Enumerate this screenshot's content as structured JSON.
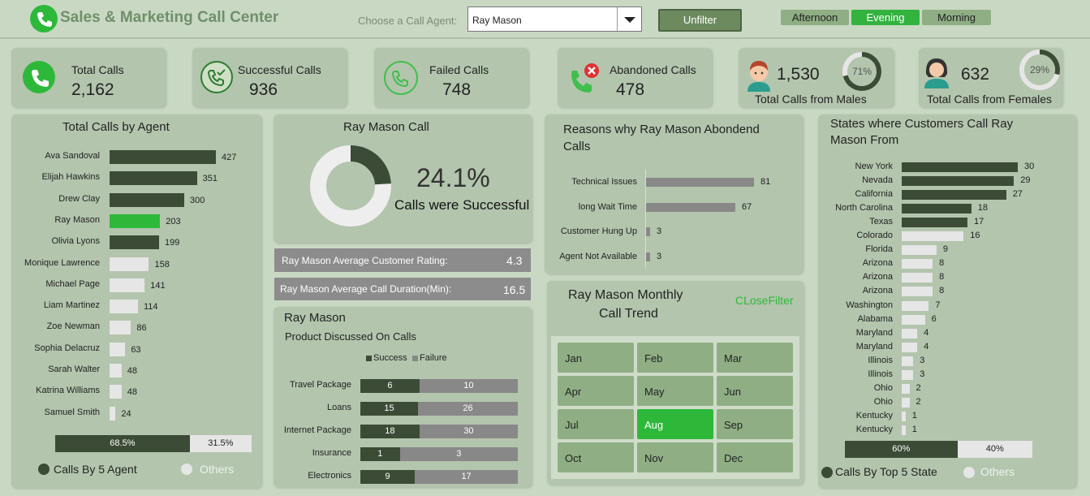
{
  "header": {
    "title": "Sales & Marketing Call Center",
    "agent_label": "Choose a Call Agent:",
    "agent_selected": "Ray Mason",
    "unfilter_label": "Unfilter",
    "time_slicers": [
      {
        "label": "Afternoon",
        "active": false
      },
      {
        "label": "Evening",
        "active": true
      },
      {
        "label": "Morning",
        "active": false
      }
    ]
  },
  "kpis": {
    "total_calls": {
      "label": "Total Calls",
      "value": "2,162"
    },
    "successful_calls": {
      "label": "Successful Calls",
      "value": "936"
    },
    "failed_calls": {
      "label": "Failed Calls",
      "value": "748"
    },
    "abandoned_calls": {
      "label": "Abandoned Calls",
      "value": "478"
    },
    "males": {
      "label": "Total Calls from Males",
      "value": "1,530",
      "pct": "71%",
      "fraction": 0.71
    },
    "females": {
      "label": "Total Calls from Females",
      "value": "632",
      "pct": "29%",
      "fraction": 0.29
    }
  },
  "agents_panel": {
    "title": "Total Calls by Agent",
    "split_left": "68.5%",
    "split_right": "31.5%",
    "split_fraction": 0.685,
    "legend_left": "Calls By 5 Agent",
    "legend_right": "Others"
  },
  "success_panel": {
    "title": "Ray Mason Call",
    "pct": "24.1%",
    "fraction": 0.241,
    "caption": "Calls were Successful",
    "rating_label": "Ray Mason Average Customer Rating:",
    "rating_value": "4.3",
    "duration_label": "Ray Mason Average Call Duration(Min):",
    "duration_value": "16.5"
  },
  "product_panel": {
    "title": "Ray Mason",
    "subtitle": "Product Discussed On Calls",
    "legend_success": "Success",
    "legend_failure": "Failure"
  },
  "reasons_panel": {
    "title_line1": "Reasons why Ray Mason Abondend",
    "title_line2": "Calls"
  },
  "monthly_panel": {
    "title_line1": "Ray Mason Monthly",
    "title_line2": "Call Trend",
    "close_filter": "CLoseFilter",
    "months": [
      "Jan",
      "Feb",
      "Mar",
      "Apr",
      "May",
      "Jun",
      "Jul",
      "Aug",
      "Sep",
      "Oct",
      "Nov",
      "Dec"
    ],
    "active_month": "Aug"
  },
  "states_panel": {
    "title_line1": "States where Customers Call Ray",
    "title_line2": "Mason From",
    "split_left": "60%",
    "split_right": "40%",
    "split_fraction": 0.6,
    "legend_left": "Calls By Top 5 State",
    "legend_right": "Others"
  },
  "colors": {
    "dark_bar": "#3c4b35",
    "highlight_bar": "#2eb83a",
    "light_bar": "#e6e6e6",
    "gray_bar": "#888888",
    "panel_bg": "#b3c5ad",
    "page_bg": "#c9d8c3"
  },
  "chart_data": [
    {
      "type": "bar",
      "orientation": "horizontal",
      "title": "Total Calls by Agent",
      "categories": [
        "Ava Sandoval",
        "Elijah Hawkins",
        "Drew Clay",
        "Ray Mason",
        "Olivia Lyons",
        "Monique Lawrence",
        "Michael Page",
        "Liam Martinez",
        "Zoe Newman",
        "Sophia Delacruz",
        "Sarah Walter",
        "Katrina Williams",
        "Samuel Smith"
      ],
      "values": [
        427,
        351,
        300,
        203,
        199,
        158,
        141,
        114,
        86,
        63,
        48,
        48,
        24
      ],
      "highlight": "Ray Mason",
      "top_n": 5
    },
    {
      "type": "pie",
      "title": "Ray Mason Call",
      "values": [
        24.1,
        75.9
      ]
    },
    {
      "type": "bar",
      "orientation": "horizontal",
      "title": "Reasons why Ray Mason Abondend Calls",
      "categories": [
        "Technical Issues",
        "long Wait Time",
        "Customer Hung Up",
        "Agent Not Available"
      ],
      "values": [
        81,
        67,
        3,
        3
      ]
    },
    {
      "type": "bar",
      "orientation": "horizontal",
      "stacked": true,
      "title": "Product Discussed On Calls",
      "categories": [
        "Travel Package",
        "Loans",
        "Internet Package",
        "Insurance",
        "Electronics"
      ],
      "series": [
        {
          "name": "Success",
          "values": [
            6,
            15,
            18,
            1,
            9
          ]
        },
        {
          "name": "Failure",
          "values": [
            10,
            26,
            30,
            3,
            17
          ]
        }
      ]
    },
    {
      "type": "bar",
      "orientation": "horizontal",
      "title": "States where Customers Call Ray Mason From",
      "categories": [
        "New York",
        "Nevada",
        "California",
        "North Carolina",
        "Texas",
        "Colorado",
        "Florida",
        "Arizona",
        "Arizona",
        "Arizona",
        "Washington",
        "Alabama",
        "Maryland",
        "Maryland",
        "Illinois",
        "Illinois",
        "Ohio",
        "Ohio",
        "Kentucky",
        "Kentucky"
      ],
      "values": [
        30,
        29,
        27,
        18,
        17,
        16,
        9,
        8,
        8,
        8,
        7,
        6,
        4,
        4,
        3,
        3,
        2,
        2,
        1,
        1
      ],
      "top_n": 5
    }
  ]
}
